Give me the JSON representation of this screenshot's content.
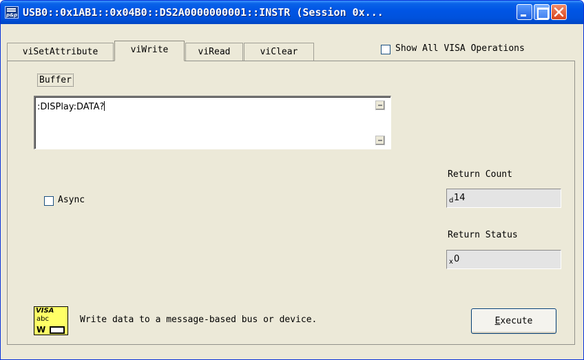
{
  "window": {
    "title": "USB0::0x1AB1::0x04B0::DS2A0000000001::INSTR (Session 0x..."
  },
  "titlebar_icon": {
    "name": "nivisa-window-icon",
    "text": "p&p"
  },
  "tabs": [
    {
      "label": "viSetAttribute",
      "active": false
    },
    {
      "label": "viWrite",
      "active": true
    },
    {
      "label": "viRead",
      "active": false
    },
    {
      "label": "viClear",
      "active": false
    }
  ],
  "show_all": {
    "label": "Show All VISA Operations",
    "checked": false
  },
  "buffer": {
    "label": "Buffer",
    "value": ":DISPlay:DATA?"
  },
  "async": {
    "label": "Async",
    "checked": false
  },
  "return_count": {
    "label": "Return Count",
    "radix": "d",
    "value": "14"
  },
  "return_status": {
    "label": "Return Status",
    "radix": "x",
    "value": "0"
  },
  "vi_icon": {
    "line1": "VISA",
    "line2": "abc",
    "line3": "W"
  },
  "description": "Write data to a message-based bus or device.",
  "execute": {
    "underline": "E",
    "rest": "xecute"
  },
  "colors": {
    "titlebar": "#0055e5",
    "window_bg": "#ece9d8",
    "icon_bg": "#ffff66"
  }
}
